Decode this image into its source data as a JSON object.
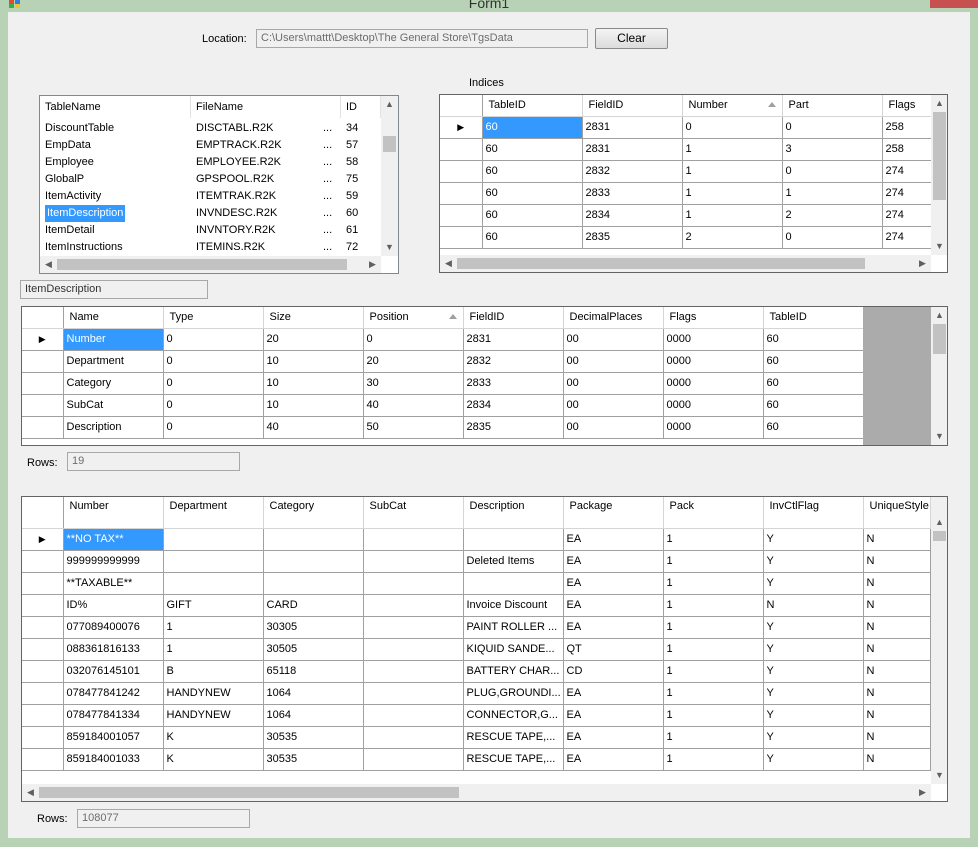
{
  "window": {
    "title": "Form1"
  },
  "location": {
    "label": "Location:",
    "path": "C:\\Users\\mattt\\Desktop\\The General Store\\TgsData",
    "clear_label": "Clear"
  },
  "tables_list": {
    "headers": [
      "TableName",
      "FileName",
      "ID"
    ],
    "rows": [
      [
        "DiscountTable",
        "DISCTABL.R2K",
        "34"
      ],
      [
        "EmpData",
        "EMPTRACK.R2K",
        "57"
      ],
      [
        "Employee",
        "EMPLOYEE.R2K",
        "58"
      ],
      [
        "GlobalP",
        "GPSPOOL.R2K",
        "75"
      ],
      [
        "ItemActivity",
        "ITEMTRAK.R2K",
        "59"
      ],
      [
        "ItemDescription",
        "INVNDESC.R2K",
        "60"
      ],
      [
        "ItemDetail",
        "INVNTORY.R2K",
        "61"
      ],
      [
        "ItemInstructions",
        "ITEMINS.R2K",
        "72"
      ]
    ],
    "ellipsis": "...",
    "selected_index": 5
  },
  "indices": {
    "label": "Indices",
    "columns": [
      "TableID",
      "FieldID",
      "Number",
      "Part",
      "Flags"
    ],
    "sorted_column": 2,
    "rows": [
      [
        "60",
        "2831",
        "0",
        "0",
        "258"
      ],
      [
        "60",
        "2831",
        "1",
        "3",
        "258"
      ],
      [
        "60",
        "2832",
        "1",
        "0",
        "274"
      ],
      [
        "60",
        "2833",
        "1",
        "1",
        "274"
      ],
      [
        "60",
        "2834",
        "1",
        "2",
        "274"
      ],
      [
        "60",
        "2835",
        "2",
        "0",
        "274"
      ]
    ]
  },
  "selected_table_name": "ItemDescription",
  "fields": {
    "columns": [
      "Name",
      "Type",
      "Size",
      "Position",
      "FieldID",
      "DecimalPlaces",
      "Flags",
      "TableID"
    ],
    "sorted_column": 3,
    "rows": [
      [
        "Number",
        "0",
        "20",
        "0",
        "2831",
        "00",
        "0000",
        "60"
      ],
      [
        "Department",
        "0",
        "10",
        "20",
        "2832",
        "00",
        "0000",
        "60"
      ],
      [
        "Category",
        "0",
        "10",
        "30",
        "2833",
        "00",
        "0000",
        "60"
      ],
      [
        "SubCat",
        "0",
        "10",
        "40",
        "2834",
        "00",
        "0000",
        "60"
      ],
      [
        "Description",
        "0",
        "40",
        "50",
        "2835",
        "00",
        "0000",
        "60"
      ]
    ],
    "rows_label": "Rows:",
    "rows_count": "19"
  },
  "data_grid": {
    "columns": [
      "Number",
      "Department",
      "Category",
      "SubCat",
      "Description",
      "Package",
      "Pack",
      "InvCtlFlag",
      "UniqueStyle"
    ],
    "rows": [
      [
        "**NO TAX**",
        "",
        "",
        "",
        "",
        "EA",
        "1",
        "Y",
        "N"
      ],
      [
        "999999999999",
        "",
        "",
        "",
        "Deleted Items",
        "EA",
        "1",
        "Y",
        "N"
      ],
      [
        "**TAXABLE**",
        "",
        "",
        "",
        "",
        "EA",
        "1",
        "Y",
        "N"
      ],
      [
        "ID%",
        "GIFT",
        "CARD",
        "",
        "Invoice Discount",
        "EA",
        "1",
        "N",
        "N"
      ],
      [
        "077089400076",
        "1",
        "30305",
        "",
        "PAINT ROLLER ...",
        "EA",
        "1",
        "Y",
        "N"
      ],
      [
        "088361816133",
        "1",
        "30505",
        "",
        "KIQUID SANDE...",
        "QT",
        "1",
        "Y",
        "N"
      ],
      [
        "032076145101",
        "B",
        "65118",
        "",
        "BATTERY CHAR...",
        "CD",
        "1",
        "Y",
        "N"
      ],
      [
        "078477841242",
        "HANDYNEW",
        "1064",
        "",
        "PLUG,GROUNDI...",
        "EA",
        "1",
        "Y",
        "N"
      ],
      [
        "078477841334",
        "HANDYNEW",
        "1064",
        "",
        "CONNECTOR,G...",
        "EA",
        "1",
        "Y",
        "N"
      ],
      [
        "859184001057",
        "K",
        "30535",
        "",
        "RESCUE TAPE,...",
        "EA",
        "1",
        "Y",
        "N"
      ],
      [
        "859184001033",
        "K",
        "30535",
        "",
        "RESCUE TAPE,...",
        "EA",
        "1",
        "Y",
        "N"
      ]
    ],
    "rows_label": "Rows:",
    "rows_count": "108077"
  }
}
